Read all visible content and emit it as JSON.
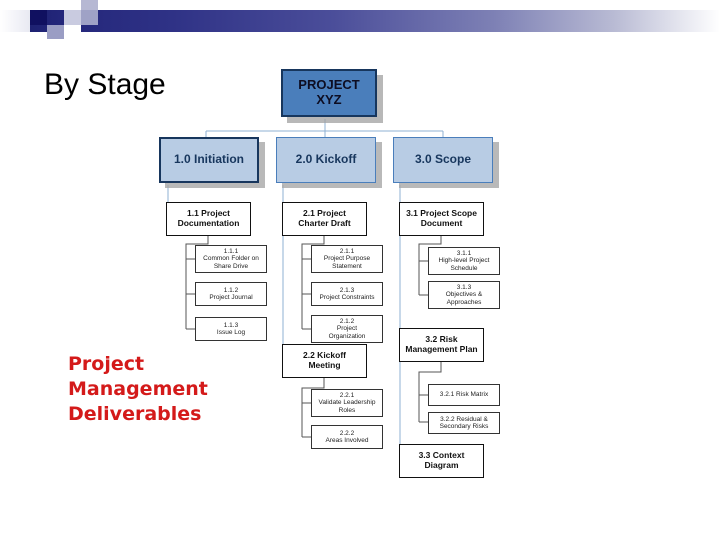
{
  "slide": {
    "title_text": "By Stage",
    "caption_lines": [
      "Project",
      "Management",
      "Deliverables"
    ],
    "caption_color": "#d41a1a"
  },
  "colors": {
    "root_fill": "#4a7ebb",
    "root_border": "#17365d",
    "stage_fill": "#b8cce4",
    "stage_border": "#4a7ebb",
    "stage_highlight_border": "#17365d",
    "box_fill": "#ffffff",
    "box_border": "#111111",
    "connector": "#8fb0d3",
    "connector_dark": "#555555",
    "band_dark": "#1b1f6e",
    "band_light": "#ffffff"
  },
  "chart_data": {
    "type": "diagram",
    "diagram_kind": "org-chart",
    "title": "By Stage",
    "root": {
      "id": "root",
      "label": "PROJECT XYZ",
      "lines": [
        "PROJECT",
        "XYZ"
      ]
    },
    "stages": [
      {
        "id": "1.0",
        "label": "1.0 Initiation",
        "highlighted": true,
        "children": [
          {
            "id": "1.1",
            "lines": [
              "1.1 Project",
              "Documentation"
            ],
            "children": [
              {
                "id": "1.1.1",
                "num": "1.1.1",
                "lines": [
                  "Common Folder on",
                  "Share Drive"
                ]
              },
              {
                "id": "1.1.2",
                "num": "1.1.2",
                "lines": [
                  "Project Journal"
                ]
              },
              {
                "id": "1.1.3",
                "num": "1.1.3",
                "lines": [
                  "Issue Log"
                ]
              }
            ]
          }
        ]
      },
      {
        "id": "2.0",
        "label": "2.0 Kickoff",
        "highlighted": false,
        "children": [
          {
            "id": "2.1",
            "lines": [
              "2.1 Project",
              "Charter Draft"
            ],
            "children": [
              {
                "id": "2.1.1",
                "num": "2.1.1",
                "lines": [
                  "Project Purpose",
                  "Statement"
                ]
              },
              {
                "id": "2.1.3",
                "num": "2.1.3",
                "lines": [
                  "Project Constraints"
                ]
              },
              {
                "id": "2.1.2",
                "num": "2.1.2",
                "lines": [
                  "Project",
                  "Organization"
                ]
              }
            ]
          },
          {
            "id": "2.2",
            "lines": [
              "2.2 Kickoff",
              "Meeting"
            ],
            "children": [
              {
                "id": "2.2.1",
                "num": "2.2.1",
                "lines": [
                  "Validate Leadership",
                  "Roles"
                ]
              },
              {
                "id": "2.2.2",
                "num": "2.2.2",
                "lines": [
                  "Areas Involved"
                ]
              }
            ]
          }
        ]
      },
      {
        "id": "3.0",
        "label": "3.0 Scope",
        "highlighted": false,
        "children": [
          {
            "id": "3.1",
            "lines": [
              "3.1 Project Scope",
              "Document"
            ],
            "children": [
              {
                "id": "3.1.1",
                "num": "3.1.1",
                "lines": [
                  "High-level Project",
                  "Schedule"
                ]
              },
              {
                "id": "3.1.3",
                "num": "3.1.3",
                "lines": [
                  "Objectives &",
                  "Approaches"
                ]
              }
            ]
          },
          {
            "id": "3.2",
            "lines": [
              "3.2 Risk",
              "Management Plan"
            ],
            "children": [
              {
                "id": "3.2.1",
                "num": "",
                "lines": [
                  "3.2.1 Risk Matrix"
                ]
              },
              {
                "id": "3.2.2",
                "num": "",
                "lines": [
                  "3.2.2 Residual &",
                  "Secondary Risks"
                ]
              }
            ]
          },
          {
            "id": "3.3",
            "lines": [
              "3.3 Context",
              "Diagram"
            ],
            "children": []
          }
        ]
      }
    ]
  },
  "nodes": {
    "root": {
      "lines": [
        "PROJECT",
        "XYZ"
      ]
    },
    "s1": {
      "lines": [
        "1.0 Initiation"
      ]
    },
    "s2": {
      "lines": [
        "2.0 Kickoff"
      ]
    },
    "s3": {
      "lines": [
        "3.0 Scope"
      ]
    },
    "d11": {
      "lines": [
        "1.1 Project",
        "Documentation"
      ]
    },
    "d21": {
      "lines": [
        "2.1 Project",
        "Charter Draft"
      ]
    },
    "d31": {
      "lines": [
        "3.1 Project Scope",
        "Document"
      ]
    },
    "d22": {
      "lines": [
        "2.2 Kickoff",
        "Meeting"
      ]
    },
    "d32": {
      "lines": [
        "3.2 Risk",
        "Management Plan"
      ]
    },
    "d33": {
      "lines": [
        "3.3 Context",
        "Diagram"
      ]
    },
    "l111": {
      "lines": [
        "1.1.1",
        "Common Folder on",
        "Share Drive"
      ]
    },
    "l112": {
      "lines": [
        "1.1.2",
        "Project Journal"
      ]
    },
    "l113": {
      "lines": [
        "1.1.3",
        "Issue Log"
      ]
    },
    "l211": {
      "lines": [
        "2.1.1",
        "Project Purpose",
        "Statement"
      ]
    },
    "l213": {
      "lines": [
        "2.1.3",
        "Project Constraints"
      ]
    },
    "l212": {
      "lines": [
        "2.1.2",
        "Project",
        "Organization"
      ]
    },
    "l221": {
      "lines": [
        "2.2.1",
        "Validate Leadership",
        "Roles"
      ]
    },
    "l222": {
      "lines": [
        "2.2.2",
        "Areas Involved"
      ]
    },
    "l311": {
      "lines": [
        "3.1.1",
        "High-level Project",
        "Schedule"
      ]
    },
    "l313": {
      "lines": [
        "3.1.3",
        "Objectives &",
        "Approaches"
      ]
    },
    "l321": {
      "lines": [
        "3.2.1 Risk Matrix"
      ]
    },
    "l322": {
      "lines": [
        "3.2.2 Residual &",
        "Secondary Risks"
      ]
    }
  }
}
